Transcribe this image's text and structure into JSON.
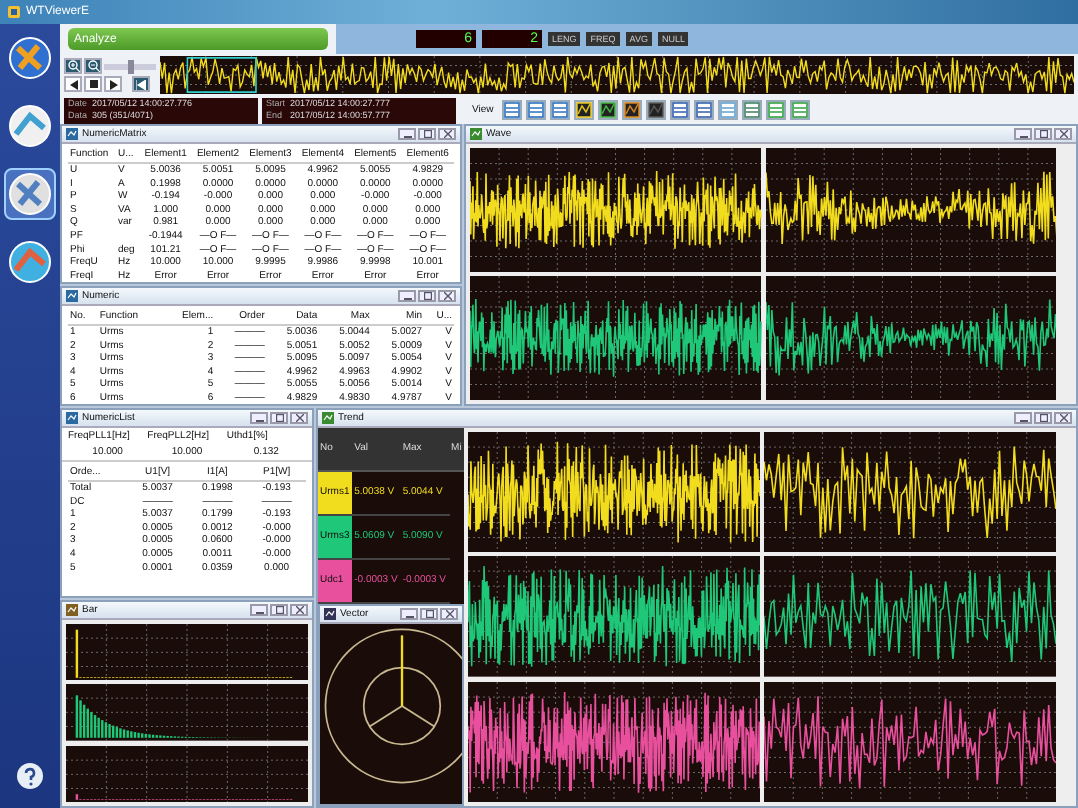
{
  "window": {
    "title": "WTViewerE"
  },
  "sidebar": {
    "items": [
      {
        "selected": false
      },
      {
        "selected": false
      },
      {
        "selected": true
      },
      {
        "selected": false
      }
    ]
  },
  "header": {
    "mode": "Analyze",
    "readouts": [
      "6",
      "2"
    ],
    "buttons": [
      "LENG",
      "FREQ",
      "AVG",
      "NULL"
    ]
  },
  "overview": {
    "slider": {
      "level": 0.5
    }
  },
  "info": [
    {
      "label": "Date",
      "value": "2017/05/12 14:00:27.776"
    },
    {
      "label": "Data",
      "value": "305 (351/4071)"
    },
    {
      "label": "Start",
      "value": "2017/05/12 14:00:27.777"
    },
    {
      "label": "End",
      "value": "2017/05/12 14:00:57.777"
    }
  ],
  "toolbar": {
    "label": "View"
  },
  "numeric_matrix": {
    "title": "NumericMatrix",
    "columns": [
      "Function",
      "U...",
      "Element1",
      "Element2",
      "Element3",
      "Element4",
      "Element5",
      "Element6"
    ],
    "rows": [
      [
        "U",
        "V",
        "5.0036",
        "5.0051",
        "5.0095",
        "4.9962",
        "5.0055",
        "4.9829"
      ],
      [
        "I",
        "A",
        "0.1998",
        "0.0000",
        "0.0000",
        "0.0000",
        "0.0000",
        "0.0000"
      ],
      [
        "P",
        "W",
        "-0.194",
        "-0.000",
        "0.000",
        "0.000",
        "-0.000",
        "-0.000"
      ],
      [
        "S",
        "VA",
        "1.000",
        "0.000",
        "0.000",
        "0.000",
        "0.000",
        "0.000"
      ],
      [
        "Q",
        "var",
        "0.981",
        "0.000",
        "0.000",
        "0.000",
        "0.000",
        "0.000"
      ],
      [
        "PF",
        null,
        "-0.1944",
        "—O F—",
        "—O F—",
        "—O F—",
        "—O F—",
        "—O F—"
      ],
      [
        "Phi",
        "deg",
        "101.21",
        "—O F—",
        "—O F—",
        "—O F—",
        "—O F—",
        "—O F—"
      ],
      [
        "FreqU",
        "Hz",
        "10.000",
        "10.000",
        "9.9995",
        "9.9986",
        "9.9998",
        "10.001"
      ],
      [
        "FreqI",
        "Hz",
        "Error",
        "Error",
        "Error",
        "Error",
        "Error",
        "Error"
      ]
    ]
  },
  "numeric": {
    "title": "Numeric",
    "columns": [
      "No.",
      "Function",
      "Elem...",
      "Order",
      "Data",
      "Max",
      "Min",
      "U..."
    ],
    "rows": [
      [
        "1",
        "Urms",
        "1",
        "———",
        "5.0036",
        "5.0044",
        "5.0027",
        "V"
      ],
      [
        "2",
        "Urms",
        "2",
        "———",
        "5.0051",
        "5.0052",
        "5.0009",
        "V"
      ],
      [
        "3",
        "Urms",
        "3",
        "———",
        "5.0095",
        "5.0097",
        "5.0054",
        "V"
      ],
      [
        "4",
        "Urms",
        "4",
        "———",
        "4.9962",
        "4.9963",
        "4.9902",
        "V"
      ],
      [
        "5",
        "Urms",
        "5",
        "———",
        "5.0055",
        "5.0056",
        "5.0014",
        "V"
      ],
      [
        "6",
        "Urms",
        "6",
        "———",
        "4.9829",
        "4.9830",
        "4.9787",
        "V"
      ]
    ]
  },
  "wave": {
    "title": "Wave",
    "traces": [
      {
        "color": "#f2dc1e"
      },
      {
        "color": "#1ec878"
      }
    ]
  },
  "numeric_list": {
    "title": "NumericList",
    "summary": [
      {
        "label": "FreqPLL1[Hz]",
        "value": "10.000"
      },
      {
        "label": "FreqPLL2[Hz]",
        "value": "10.000"
      },
      {
        "label": "Uthd1[%]",
        "value": "0.132"
      }
    ],
    "columns": [
      "Orde...",
      "U1[V]",
      "I1[A]",
      "P1[W]"
    ],
    "rows": [
      [
        "Total",
        "5.0037",
        "0.1998",
        "-0.193"
      ],
      [
        "DC",
        "———",
        "———",
        "———"
      ],
      [
        "1",
        "5.0037",
        "0.1799",
        "-0.193"
      ],
      [
        "2",
        "0.0005",
        "0.0012",
        "-0.000"
      ],
      [
        "3",
        "0.0005",
        "0.0600",
        "-0.000"
      ],
      [
        "4",
        "0.0005",
        "0.0011",
        "-0.000"
      ],
      [
        "5",
        "0.0001",
        "0.0359",
        "0.000"
      ]
    ]
  },
  "trend": {
    "title": "Trend",
    "columns": [
      "No",
      "Val",
      "Max",
      "Mi"
    ],
    "rows": [
      {
        "name": "Urms1",
        "val": "5.0038 V",
        "max": "5.0044 V",
        "color": "#f2dc1e"
      },
      {
        "name": "Urms3",
        "val": "5.0609 V",
        "max": "5.0090 V",
        "color": "#1ec878"
      },
      {
        "name": "Udc1",
        "val": "-0.0003 V",
        "max": "-0.0003 V",
        "color": "#e8509e"
      }
    ]
  },
  "bar": {
    "title": "Bar"
  },
  "vector": {
    "title": "Vector"
  }
}
